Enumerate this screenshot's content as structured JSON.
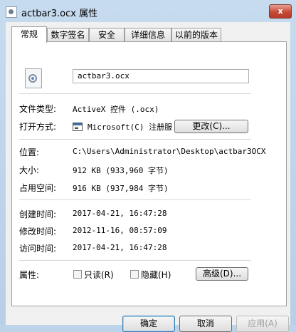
{
  "window": {
    "title": "actbar3.ocx 属性",
    "close_label": "x"
  },
  "tabs": [
    {
      "label": "常规"
    },
    {
      "label": "数字签名"
    },
    {
      "label": "安全"
    },
    {
      "label": "详细信息"
    },
    {
      "label": "以前的版本"
    }
  ],
  "general": {
    "file_name": "actbar3.ocx",
    "type_label": "文件类型:",
    "type_value": "ActiveX 控件 (.ocx)",
    "opens_with_label": "打开方式:",
    "opens_with_value": "Microsoft(C) 注册服",
    "change_button": "更改(C)...",
    "location_label": "位置:",
    "location_value": "C:\\Users\\Administrator\\Desktop\\actbar3OCX",
    "size_label": "大小:",
    "size_value": "912 KB (933,960 字节)",
    "size_on_disk_label": "占用空间:",
    "size_on_disk_value": "916 KB (937,984 字节)",
    "created_label": "创建时间:",
    "created_value": "2017-04-21, 16:47:28",
    "modified_label": "修改时间:",
    "modified_value": "2012-11-16, 08:57:09",
    "accessed_label": "访问时间:",
    "accessed_value": "2017-04-21, 16:47:28",
    "attributes_label": "属性:",
    "readonly_label": "只读(R)",
    "hidden_label": "隐藏(H)",
    "advanced_button": "高级(D)..."
  },
  "footer": {
    "ok": "确定",
    "cancel": "取消",
    "apply": "应用(A)"
  }
}
